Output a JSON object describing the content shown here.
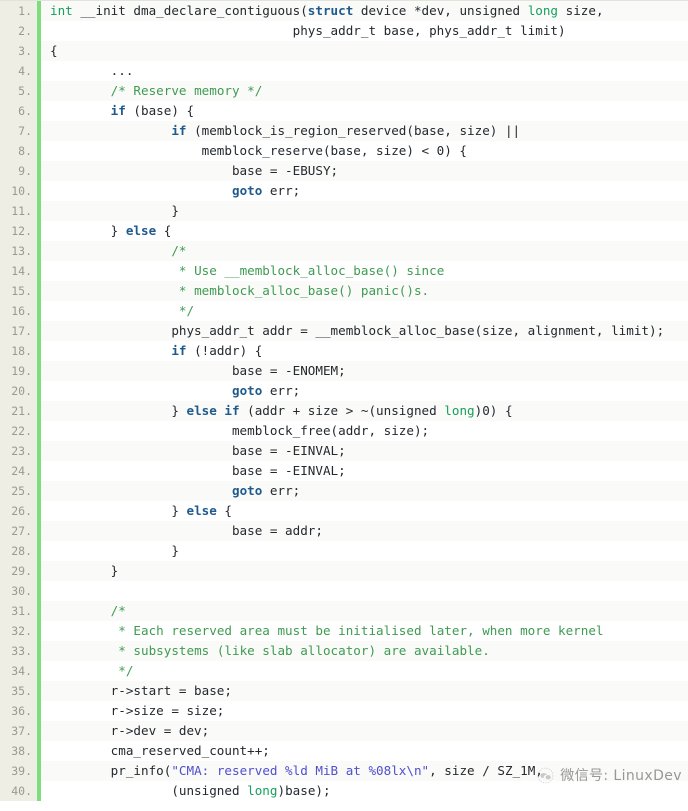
{
  "viewer": {
    "name": "code-snippet-viewer",
    "language": "c",
    "first_line": 1,
    "last_line": 40,
    "gutter_accent_color": "#7ede7e",
    "gutter_background": "#eeeee4",
    "stripe_color": "#fafaf9",
    "background": "#ffffff"
  },
  "theme": {
    "plain": "#24292e",
    "keyword": "#1f5a8c",
    "type": "#16a05a",
    "comment": "#3f9b52",
    "string": "#4f4fd0",
    "line_number": "#9a9a90"
  },
  "watermark": {
    "logo_icon": "wechat-logo-icon",
    "text": "微信号: LinuxDev"
  },
  "lines": [
    {
      "n": "1.",
      "tokens": [
        {
          "t": "type",
          "v": "int"
        },
        {
          "t": "plain",
          "v": " __init dma_declare_contiguous("
        },
        {
          "t": "keyword",
          "v": "struct"
        },
        {
          "t": "plain",
          "v": " device *dev, unsigned "
        },
        {
          "t": "type",
          "v": "long"
        },
        {
          "t": "plain",
          "v": " size,"
        }
      ]
    },
    {
      "n": "2.",
      "tokens": [
        {
          "t": "plain",
          "v": "                                phys_addr_t base, phys_addr_t limit)"
        }
      ]
    },
    {
      "n": "3.",
      "tokens": [
        {
          "t": "plain",
          "v": "{"
        }
      ]
    },
    {
      "n": "4.",
      "tokens": [
        {
          "t": "plain",
          "v": "        ..."
        }
      ]
    },
    {
      "n": "5.",
      "tokens": [
        {
          "t": "plain",
          "v": "        "
        },
        {
          "t": "comment",
          "v": "/* Reserve memory */"
        }
      ]
    },
    {
      "n": "6.",
      "tokens": [
        {
          "t": "plain",
          "v": "        "
        },
        {
          "t": "keyword",
          "v": "if"
        },
        {
          "t": "plain",
          "v": " (base) {"
        }
      ]
    },
    {
      "n": "7.",
      "tokens": [
        {
          "t": "plain",
          "v": "                "
        },
        {
          "t": "keyword",
          "v": "if"
        },
        {
          "t": "plain",
          "v": " (memblock_is_region_reserved(base, size) ||"
        }
      ]
    },
    {
      "n": "8.",
      "tokens": [
        {
          "t": "plain",
          "v": "                    memblock_reserve(base, size) < 0) {"
        }
      ]
    },
    {
      "n": "9.",
      "tokens": [
        {
          "t": "plain",
          "v": "                        base = -EBUSY;"
        }
      ]
    },
    {
      "n": "10.",
      "tokens": [
        {
          "t": "plain",
          "v": "                        "
        },
        {
          "t": "keyword",
          "v": "goto"
        },
        {
          "t": "plain",
          "v": " err;"
        }
      ]
    },
    {
      "n": "11.",
      "tokens": [
        {
          "t": "plain",
          "v": "                }"
        }
      ]
    },
    {
      "n": "12.",
      "tokens": [
        {
          "t": "plain",
          "v": "        } "
        },
        {
          "t": "keyword",
          "v": "else"
        },
        {
          "t": "plain",
          "v": " {"
        }
      ]
    },
    {
      "n": "13.",
      "tokens": [
        {
          "t": "plain",
          "v": "                "
        },
        {
          "t": "comment",
          "v": "/*"
        }
      ]
    },
    {
      "n": "14.",
      "tokens": [
        {
          "t": "plain",
          "v": "                 "
        },
        {
          "t": "comment",
          "v": "* Use __memblock_alloc_base() since"
        }
      ]
    },
    {
      "n": "15.",
      "tokens": [
        {
          "t": "plain",
          "v": "                 "
        },
        {
          "t": "comment",
          "v": "* memblock_alloc_base() panic()s."
        }
      ]
    },
    {
      "n": "16.",
      "tokens": [
        {
          "t": "plain",
          "v": "                 "
        },
        {
          "t": "comment",
          "v": "*/"
        }
      ]
    },
    {
      "n": "17.",
      "tokens": [
        {
          "t": "plain",
          "v": "                phys_addr_t addr = __memblock_alloc_base(size, alignment, limit);"
        }
      ]
    },
    {
      "n": "18.",
      "tokens": [
        {
          "t": "plain",
          "v": "                "
        },
        {
          "t": "keyword",
          "v": "if"
        },
        {
          "t": "plain",
          "v": " (!addr) {"
        }
      ]
    },
    {
      "n": "19.",
      "tokens": [
        {
          "t": "plain",
          "v": "                        base = -ENOMEM;"
        }
      ]
    },
    {
      "n": "20.",
      "tokens": [
        {
          "t": "plain",
          "v": "                        "
        },
        {
          "t": "keyword",
          "v": "goto"
        },
        {
          "t": "plain",
          "v": " err;"
        }
      ]
    },
    {
      "n": "21.",
      "tokens": [
        {
          "t": "plain",
          "v": "                } "
        },
        {
          "t": "keyword",
          "v": "else if"
        },
        {
          "t": "plain",
          "v": " (addr + size > ~(unsigned "
        },
        {
          "t": "type",
          "v": "long"
        },
        {
          "t": "plain",
          "v": ")0) {"
        }
      ]
    },
    {
      "n": "22.",
      "tokens": [
        {
          "t": "plain",
          "v": "                        memblock_free(addr, size);"
        }
      ]
    },
    {
      "n": "23.",
      "tokens": [
        {
          "t": "plain",
          "v": "                        base = -EINVAL;"
        }
      ]
    },
    {
      "n": "24.",
      "tokens": [
        {
          "t": "plain",
          "v": "                        base = -EINVAL;"
        }
      ]
    },
    {
      "n": "25.",
      "tokens": [
        {
          "t": "plain",
          "v": "                        "
        },
        {
          "t": "keyword",
          "v": "goto"
        },
        {
          "t": "plain",
          "v": " err;"
        }
      ]
    },
    {
      "n": "26.",
      "tokens": [
        {
          "t": "plain",
          "v": "                } "
        },
        {
          "t": "keyword",
          "v": "else"
        },
        {
          "t": "plain",
          "v": " {"
        }
      ]
    },
    {
      "n": "27.",
      "tokens": [
        {
          "t": "plain",
          "v": "                        base = addr;"
        }
      ]
    },
    {
      "n": "28.",
      "tokens": [
        {
          "t": "plain",
          "v": "                }"
        }
      ]
    },
    {
      "n": "29.",
      "tokens": [
        {
          "t": "plain",
          "v": "        }"
        }
      ]
    },
    {
      "n": "30.",
      "tokens": [
        {
          "t": "plain",
          "v": ""
        }
      ]
    },
    {
      "n": "31.",
      "tokens": [
        {
          "t": "plain",
          "v": "        "
        },
        {
          "t": "comment",
          "v": "/*"
        }
      ]
    },
    {
      "n": "32.",
      "tokens": [
        {
          "t": "plain",
          "v": "         "
        },
        {
          "t": "comment",
          "v": "* Each reserved area must be initialised later, when more kernel"
        }
      ]
    },
    {
      "n": "33.",
      "tokens": [
        {
          "t": "plain",
          "v": "         "
        },
        {
          "t": "comment",
          "v": "* subsystems (like slab allocator) are available."
        }
      ]
    },
    {
      "n": "34.",
      "tokens": [
        {
          "t": "plain",
          "v": "         "
        },
        {
          "t": "comment",
          "v": "*/"
        }
      ]
    },
    {
      "n": "35.",
      "tokens": [
        {
          "t": "plain",
          "v": "        r->start = base;"
        }
      ]
    },
    {
      "n": "36.",
      "tokens": [
        {
          "t": "plain",
          "v": "        r->size = size;"
        }
      ]
    },
    {
      "n": "37.",
      "tokens": [
        {
          "t": "plain",
          "v": "        r->dev = dev;"
        }
      ]
    },
    {
      "n": "38.",
      "tokens": [
        {
          "t": "plain",
          "v": "        cma_reserved_count++;"
        }
      ]
    },
    {
      "n": "39.",
      "tokens": [
        {
          "t": "plain",
          "v": "        pr_info("
        },
        {
          "t": "string",
          "v": "\"CMA: reserved %ld MiB at %08lx\\n\""
        },
        {
          "t": "plain",
          "v": ", size / SZ_1M,"
        }
      ]
    },
    {
      "n": "40.",
      "tokens": [
        {
          "t": "plain",
          "v": "                (unsigned "
        },
        {
          "t": "type",
          "v": "long"
        },
        {
          "t": "plain",
          "v": ")base);"
        }
      ]
    }
  ]
}
